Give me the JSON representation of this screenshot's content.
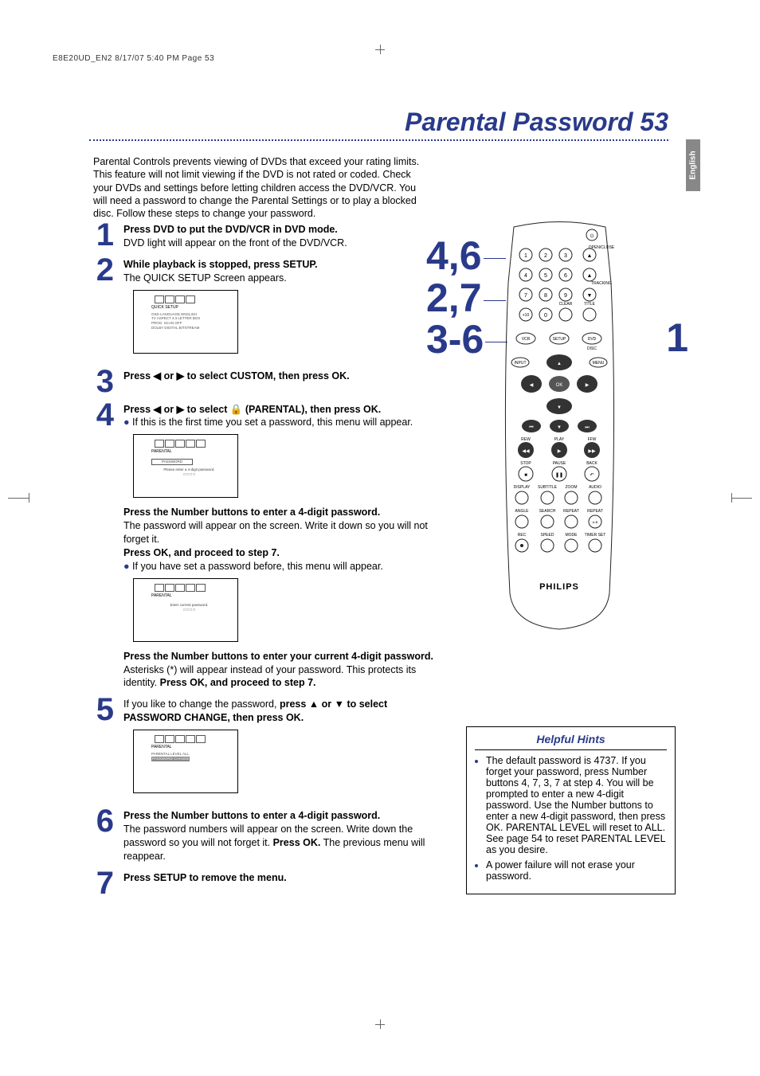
{
  "header": "E8E20UD_EN2  8/17/07  5:40 PM  Page 53",
  "lang_tab": "English",
  "title": "Parental Password  53",
  "intro": "Parental Controls prevents viewing of DVDs that exceed your rating limits. This feature will not limit viewing if the DVD is not rated or coded. Check your DVDs and settings before letting children access the DVD/VCR. You will need a password to change the Parental Settings or to play a blocked disc. Follow these steps to change your password.",
  "steps": {
    "1": {
      "bold": "Press DVD to put the DVD/VCR in DVD mode.",
      "text": "DVD light will appear on the front of the DVD/VCR."
    },
    "2": {
      "bold": "While playback is stopped, press SETUP.",
      "text": "The QUICK SETUP Screen appears.",
      "menu": {
        "title": "QUICK SETUP",
        "lines": [
          "OSD LANGUAGE    ENGLISH",
          "TV ASPECT       4:3 LETTER BOX",
          "PROG. SCAN      OFF",
          "DOLBY DIGITAL   BITSTREAM"
        ]
      }
    },
    "3": {
      "bold": "Press ◀ or ▶ to select CUSTOM, then press OK."
    },
    "4": {
      "bold": "Press ◀ or ▶ to select 🔒 (PARENTAL), then press OK.",
      "bullet": "If this is the first time you set a password, this menu will appear.",
      "menu": {
        "title": "PARENTAL",
        "sub": "PASSWORD",
        "lines": [
          "Please enter a 4-digit password.",
          "□ □ □ □"
        ]
      },
      "after1b": "Press the Number buttons to enter a 4-digit password.",
      "after1t": "The password will appear on the screen. Write it down so you will not forget it.",
      "after2b": "Press OK, and proceed to step 7.",
      "bullet2": "If you have set a password before, this menu will appear.",
      "menu2": {
        "title": "PARENTAL",
        "lines": [
          "Enter current password.",
          "□ □ □ □"
        ]
      },
      "after3b": "Press the Number buttons to enter your current 4-digit password.",
      "after3t": " Asterisks (*) will appear instead of your password. This protects its identity. ",
      "after3b2": "Press OK, and proceed to step 7."
    },
    "5": {
      "pre": "If you like to change the password, ",
      "bold": "press ▲ or ▼ to select PASSWORD CHANGE, then press OK.",
      "menu": {
        "title": "PARENTAL",
        "lines": [
          "PARENTAL LEVEL    ALL",
          "PASSWORD CHANGE"
        ]
      }
    },
    "6": {
      "bold": "Press the Number buttons to enter a 4-digit password.",
      "text": "The password numbers will appear on the screen. Write down the password so you will not forget it. ",
      "bold2": "Press OK.",
      "text2": " The previous menu will reappear."
    },
    "7": {
      "bold": "Press SETUP to remove the menu."
    }
  },
  "refs": {
    "a": "4,6",
    "b": "2,7",
    "c": "3-6",
    "one": "1"
  },
  "remote": {
    "brand": "PHILIPS",
    "labels": [
      "OPEN/CLOSE",
      "TRACKING",
      "CLEAR",
      "TITLE",
      "DISC",
      "MENU",
      "INPUT",
      "VCR",
      "SETUP",
      "DVD",
      "OK",
      "REW",
      "PLAY",
      "FFW",
      "STOP",
      "PAUSE",
      "BACK",
      "DISPLAY",
      "SUBTITLE",
      "ZOOM",
      "AUDIO",
      "ANGLE",
      "SEARCH",
      "REPEAT",
      "REPEAT",
      "A-B",
      "REC",
      "SPEED",
      "MODE",
      "TIMER SET"
    ],
    "nums": [
      "1",
      "2",
      "3",
      "4",
      "5",
      "6",
      "7",
      "8",
      "9",
      "+10",
      "0"
    ]
  },
  "hints": {
    "title": "Helpful Hints",
    "items": [
      "The default password is 4737. If you forget your password, press Number buttons 4, 7, 3, 7 at step 4. You will be prompted to enter a new 4-digit password. Use the Number buttons to enter a new 4-digit password, then press OK. PARENTAL LEVEL will reset to ALL. See page 54 to reset PARENTAL LEVEL as you desire.",
      "A power failure will not erase your password."
    ]
  }
}
